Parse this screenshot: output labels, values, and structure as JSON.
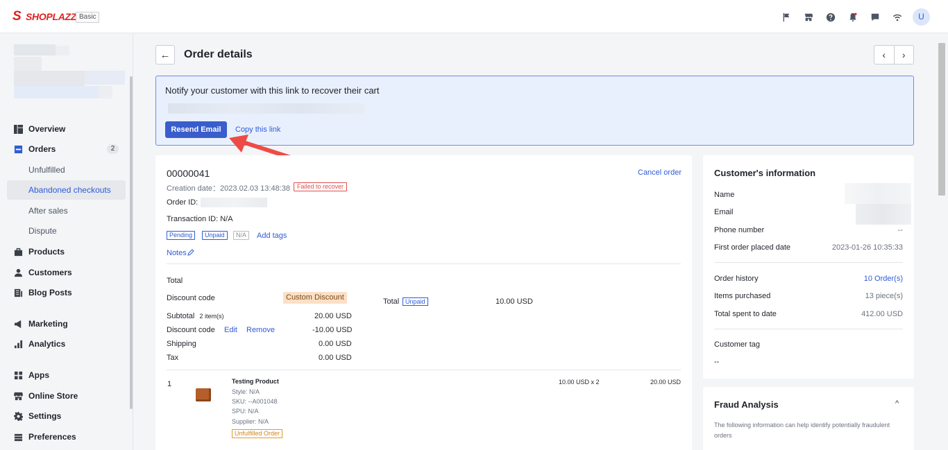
{
  "topbar": {
    "logo_text": "SHOPLAZZA",
    "plan": "Basic",
    "icons": [
      "flag-icon",
      "store-icon",
      "help-icon",
      "bell-icon",
      "chat-icon",
      "wifi-icon"
    ],
    "avatar_letter": "U"
  },
  "sidebar": {
    "items": [
      {
        "label": "Overview",
        "icon": "overview-icon"
      },
      {
        "label": "Orders",
        "icon": "orders-icon",
        "count": "2"
      },
      {
        "label": "Unfulfilled"
      },
      {
        "label": "Abandoned checkouts",
        "active": true
      },
      {
        "label": "After sales"
      },
      {
        "label": "Dispute"
      },
      {
        "label": "Products",
        "icon": "products-icon"
      },
      {
        "label": "Customers",
        "icon": "customers-icon"
      },
      {
        "label": "Blog Posts",
        "icon": "blog-icon"
      },
      {
        "label": "Marketing",
        "icon": "marketing-icon"
      },
      {
        "label": "Analytics",
        "icon": "analytics-icon"
      },
      {
        "label": "Apps",
        "icon": "apps-icon"
      },
      {
        "label": "Online Store",
        "icon": "online-store-icon"
      },
      {
        "label": "Settings",
        "icon": "settings-icon"
      },
      {
        "label": "Preferences",
        "icon": "preferences-icon"
      }
    ]
  },
  "header": {
    "back": "←",
    "title": "Order details",
    "prev": "‹",
    "next": "›"
  },
  "notify": {
    "title": "Notify your customer with this link to recover their cart",
    "resend_label": "Resend Email",
    "copy_label": "Copy this link"
  },
  "order": {
    "number": "00000041",
    "cancel_label": "Cancel order",
    "creation_label": "Creation date：",
    "creation_value": "2023.02.03 13:48:38",
    "status_tag": "Failed to recover",
    "order_id_label": "Order ID:",
    "transaction_label": "Transaction ID: N/A",
    "tags": [
      "Pending",
      "Unpaid",
      "N/A"
    ],
    "add_tags_label": "Add tags",
    "notes_label": "Notes",
    "total_heading": "Total",
    "discount_code_label": "Discount code",
    "custom_discount": "Custom Discount",
    "total_label": "Total",
    "total_tag": "Unpaid",
    "total_value": "10.00 USD",
    "subtotal_label": "Subtotal",
    "subtotal_items": "2 item(s)",
    "subtotal_value": "20.00 USD",
    "discount_label": "Discount code",
    "edit_label": "Edit",
    "remove_label": "Remove",
    "discount_value": "-10.00 USD",
    "shipping_label": "Shipping",
    "shipping_value": "0.00 USD",
    "tax_label": "Tax",
    "tax_value": "0.00 USD",
    "line_index": "1",
    "product": {
      "title": "Testing Product",
      "style": "Style: N/A",
      "sku": "SKU: --A001048",
      "spu": "SPU: N/A",
      "supplier": "Supplier: N/A",
      "status": "Unfulfilled Order",
      "unit": "10.00 USD x 2",
      "line_total": "20.00 USD"
    }
  },
  "customer": {
    "title": "Customer's information",
    "name_label": "Name",
    "email_label": "Email",
    "phone_label": "Phone number",
    "phone_value": "--",
    "first_order_label": "First order placed date",
    "first_order_value": "2023-01-26 10:35:33",
    "history_label": "Order history",
    "history_value": "10 Order(s)",
    "items_label": "Items purchased",
    "items_value": "13 piece(s)",
    "spent_label": "Total spent to date",
    "spent_value": "412.00 USD",
    "tag_label": "Customer tag",
    "tag_value": "--"
  },
  "fraud": {
    "title": "Fraud Analysis",
    "chevron": "^",
    "description": "The following information can help identify potentially fraudulent orders"
  },
  "colors": {
    "brand": "#e02020",
    "accent": "#3a5dcc",
    "link": "#2e5bd8",
    "banner_bg": "#e9f0fd",
    "arrow": "#ee4b47"
  }
}
